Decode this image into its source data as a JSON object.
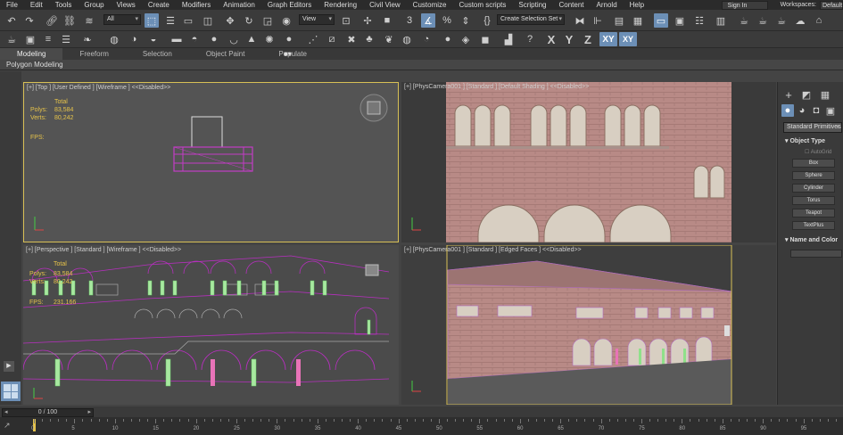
{
  "menu": [
    "File",
    "Edit",
    "Tools",
    "Group",
    "Views",
    "Create",
    "Modifiers",
    "Animation",
    "Graph Editors",
    "Rendering",
    "Civil View",
    "Customize",
    "Custom scripts",
    "Scripting",
    "Content",
    "Arnold",
    "Help"
  ],
  "account": {
    "sign_in": "Sign In",
    "workspaces_label": "Workspaces:",
    "workspace": "Default"
  },
  "toolbar": {
    "selection_filter": "All",
    "view_dropdown": "View",
    "selection_set": "Create Selection Set"
  },
  "axes": [
    "X",
    "Y",
    "Z",
    "XY",
    "XY"
  ],
  "ribbon": {
    "tabs": [
      "Modeling",
      "Freeform",
      "Selection",
      "Object Paint",
      "Populate"
    ],
    "active": "Modeling",
    "panel": "Polygon Modeling"
  },
  "viewports": {
    "top": {
      "label": "[+] [Top ] [User Defined ] [Wireframe ]  <<Disabled>>",
      "total": "Total",
      "polys_label": "Polys:",
      "polys": "83,584",
      "verts_label": "Verts:",
      "verts": "80,242",
      "fps_label": "FPS:",
      "fps": ""
    },
    "camera_top": {
      "label": "[+] [PhysCamera001 ] [Standard ] [Default Shading ]  <<Disabled>>"
    },
    "perspective": {
      "label": "[+] [Perspective ] [Standard ] [Wireframe ]  <<Disabled>>",
      "total": "Total",
      "polys_label": "Polys:",
      "polys": "83,584",
      "verts_label": "Verts:",
      "verts": "80,242",
      "fps_label": "FPS:",
      "fps": "231.166"
    },
    "camera_bottom": {
      "label": "[+] [PhysCamera001 ] [Standard ] [Edged Faces ]  <<Disabled>>"
    }
  },
  "command_panel": {
    "dropdown": "Standard Primitives",
    "object_type_title": "Object Type",
    "autogrid": "AutoGrid",
    "buttons": [
      "Box",
      "Sphere",
      "Cylinder",
      "Torus",
      "Teapot",
      "TextPlus"
    ],
    "name_color_title": "Name and Color"
  },
  "timeline": {
    "frame_display": "0 / 100",
    "ticks": [
      "0",
      "5",
      "10",
      "15",
      "20",
      "25",
      "30",
      "35",
      "40",
      "45",
      "50",
      "55",
      "60",
      "65",
      "70",
      "75",
      "80",
      "85",
      "90",
      "95"
    ]
  }
}
